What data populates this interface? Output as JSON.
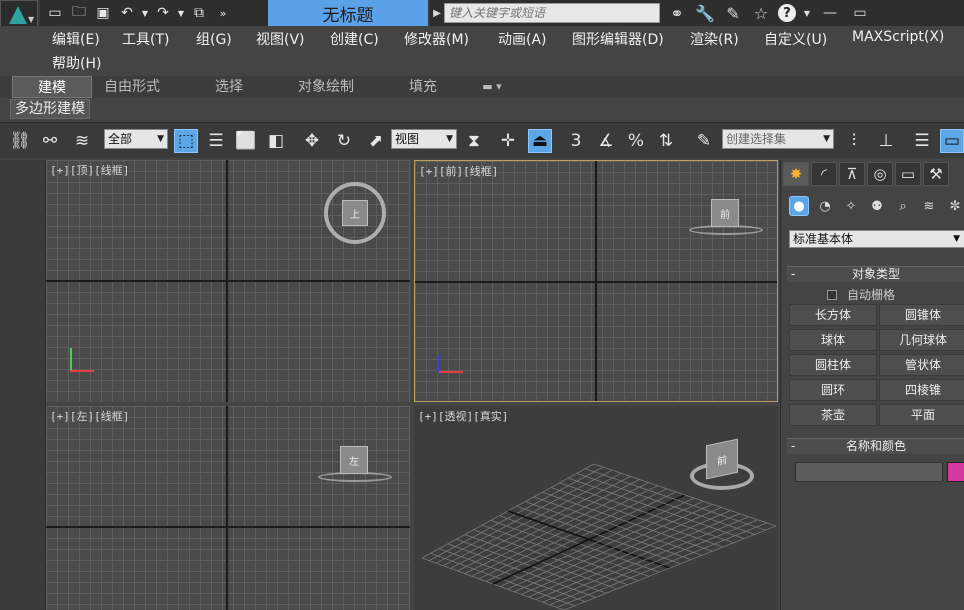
{
  "title_bar": {
    "app_logo_icon": "3dsmax-logo-icon",
    "document_title": "无标题",
    "search_placeholder": "键入关键字或短语"
  },
  "menu": {
    "items": [
      "编辑(E)",
      "工具(T)",
      "组(G)",
      "视图(V)",
      "创建(C)",
      "修改器(M)",
      "动画(A)",
      "图形编辑器(D)",
      "渲染(R)",
      "自定义(U)",
      "MAXScript(X)",
      "帮助(H)"
    ]
  },
  "ribbon": {
    "tabs": [
      "建模",
      "自由形式",
      "选择",
      "对象绘制",
      "填充"
    ],
    "active_tab": "建模",
    "sub_button": "多边形建模"
  },
  "main_toolbar": {
    "selection_filter": "全部",
    "reference_coord": "视图",
    "named_selection_placeholder": "创建选择集",
    "snap_label": "3"
  },
  "viewports": {
    "top_label": "[+][顶][线框]",
    "front_label": "[+][前][线框]",
    "left_label": "[+][左][线框]",
    "persp_label": "[+][透视][真实]",
    "top_cube": "上",
    "front_cube": "前",
    "left_cube": "左",
    "persp_cube": "前"
  },
  "command_panel": {
    "category_dropdown": "标准基本体",
    "object_type_title": "对象类型",
    "autogrid_label": "自动栅格",
    "object_buttons": [
      "长方体",
      "圆锥体",
      "球体",
      "几何球体",
      "圆柱体",
      "管状体",
      "圆环",
      "四棱锥",
      "茶壶",
      "平面"
    ],
    "name_color_title": "名称和颜色",
    "swatch_color": "#d63aa0"
  },
  "colors": {
    "accent_blue": "#5da6e6",
    "title_box": "#5aa1e8",
    "active_viewport_border": "#b8a060"
  }
}
